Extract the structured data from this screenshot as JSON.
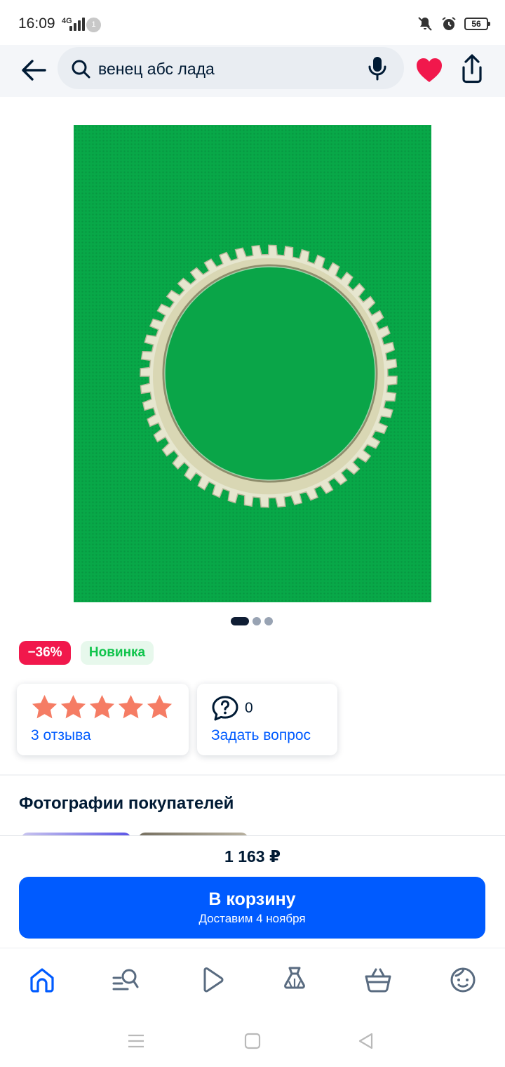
{
  "status_bar": {
    "time": "16:09",
    "network": "4G",
    "notification_count": "1",
    "battery": "56"
  },
  "search": {
    "query": "венец абс лада"
  },
  "product": {
    "image_desc_icon": "abs-ring-photo",
    "carousel": {
      "total": 3,
      "active": 1
    },
    "discount_badge": "−36%",
    "new_badge": "Новинка",
    "rating": {
      "stars": 5,
      "reviews_label": "3 отзыва"
    },
    "questions": {
      "count": "0",
      "ask_label": "Задать вопрос"
    }
  },
  "customer_photos": {
    "title": "Фотографии покупателей"
  },
  "buy": {
    "price": "1 163 ₽",
    "cart_label": "В корзину",
    "delivery": "Доставим 4 ноября"
  },
  "tab_bar": {
    "items": [
      "home-icon",
      "catalog-search-icon",
      "video-play-icon",
      "fashion-dress-icon",
      "cart-basket-icon",
      "profile-face-icon"
    ]
  },
  "colors": {
    "accent": "#005bff",
    "heart": "#f1184c",
    "star": "#f57c64",
    "new_badge_text": "#10c44c",
    "product_bg": "#08a848"
  }
}
